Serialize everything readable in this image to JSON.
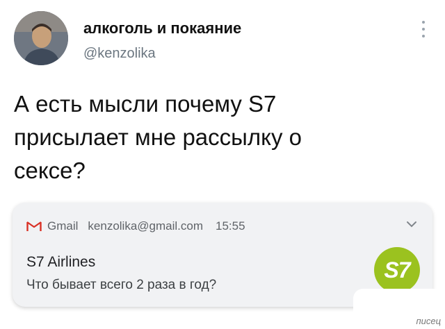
{
  "tweet": {
    "display_name": "алкоголь и покаяние",
    "handle": "@kenzolika",
    "text": "А есть мысли почему S7\nприсылает мне рассылку о\nсексе?",
    "avatar_icon": "user-avatar",
    "more_icon": "vertical-dots-icon"
  },
  "email_notification": {
    "app_name": "Gmail",
    "account": "kenzolika@gmail.com",
    "time": "15:55",
    "sender": "S7 Airlines",
    "subject": "Что бывает всего 2 раза в год?",
    "logo_text": "S7",
    "colors": {
      "logo": "#9bc21f",
      "card": "#f1f2f4",
      "gmail_red": "#d93025"
    },
    "icons": [
      "gmail-icon",
      "chevron-down-icon",
      "s7-logo"
    ]
  },
  "watermark": "писец"
}
